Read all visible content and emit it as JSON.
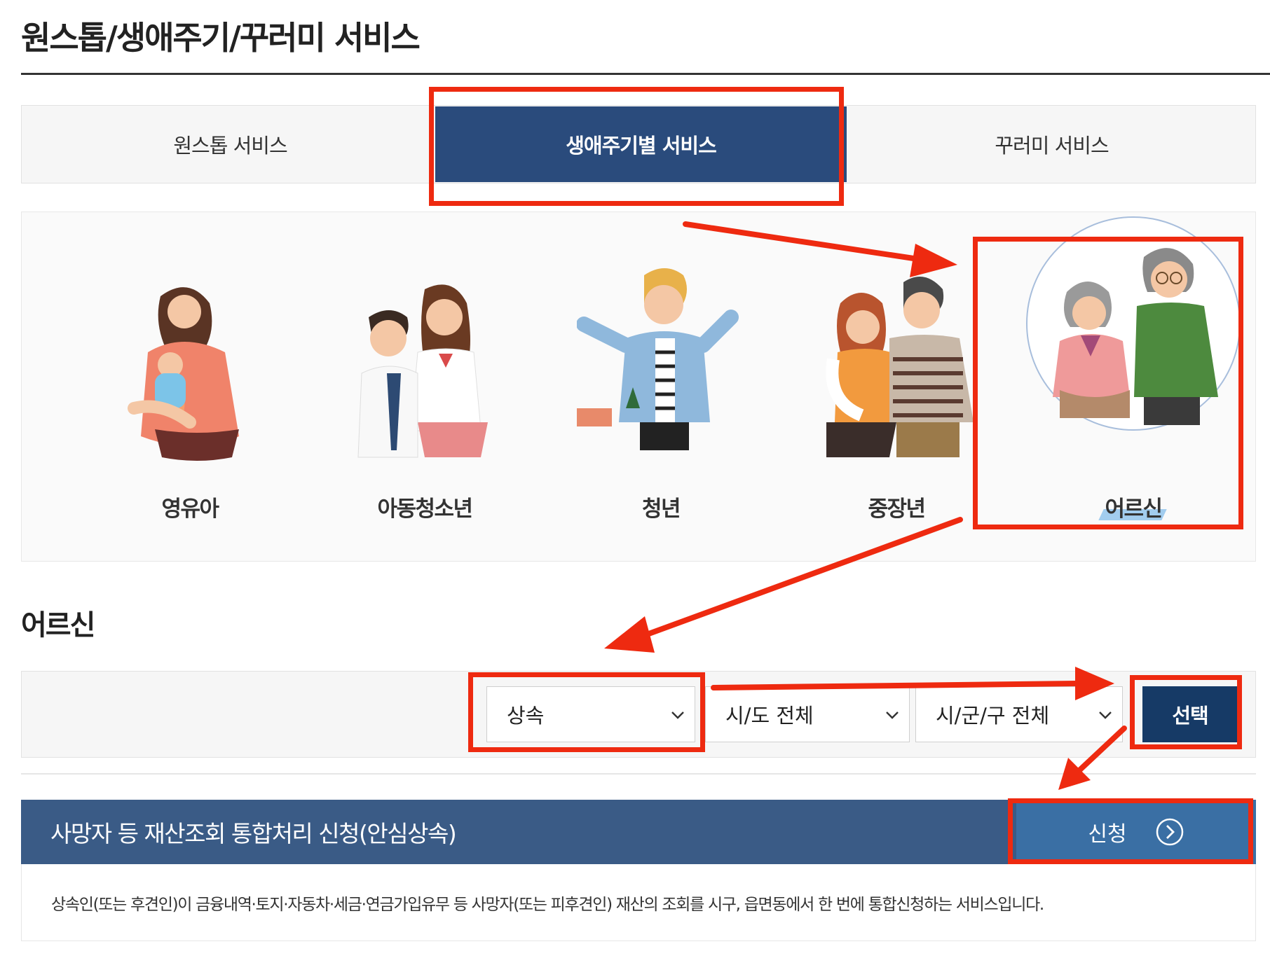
{
  "page": {
    "title": "원스톱/생애주기/꾸러미 서비스"
  },
  "tabs": [
    {
      "label": "원스톱 서비스",
      "active": false
    },
    {
      "label": "생애주기별 서비스",
      "active": true
    },
    {
      "label": "꾸러미 서비스",
      "active": false
    }
  ],
  "life_stages": [
    {
      "label": "영유아",
      "selected": false
    },
    {
      "label": "아동청소년",
      "selected": false
    },
    {
      "label": "청년",
      "selected": false
    },
    {
      "label": "중장년",
      "selected": false
    },
    {
      "label": "어르신",
      "selected": true
    }
  ],
  "section": {
    "title": "어르신"
  },
  "filters": {
    "category": "상속",
    "province": "시/도 전체",
    "district": "시/군/구 전체",
    "select_button": "선택"
  },
  "service": {
    "title": "사망자 등 재산조회 통합처리 신청(안심상속)",
    "apply_label": "신청",
    "description": "상속인(또는 후견인)이 금융내역·토지·자동차·세금·연금가입유무 등 사망자(또는 피후견인) 재산의 조회를 시구, 읍면동에서 한 번에 통합신청하는 서비스입니다."
  },
  "colors": {
    "active_tab": "#2a4b7c",
    "select_button": "#163a66",
    "service_bar": "#3a5b86",
    "apply_button": "#3a6fa4",
    "highlight": "#ee2a10"
  }
}
